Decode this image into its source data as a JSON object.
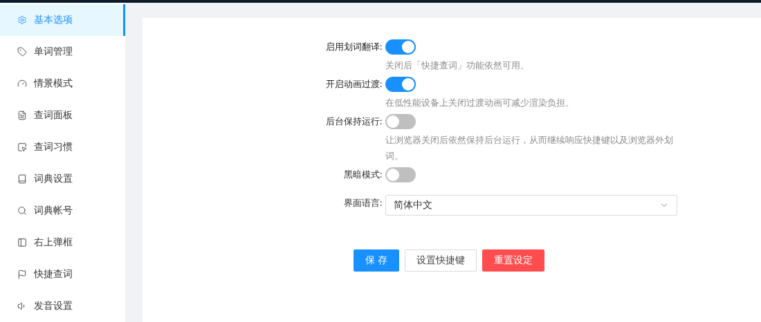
{
  "sidebar": {
    "items": [
      {
        "label": "基本选项",
        "selected": true
      },
      {
        "label": "单词管理",
        "selected": false
      },
      {
        "label": "情景模式",
        "selected": false
      },
      {
        "label": "查词面板",
        "selected": false
      },
      {
        "label": "查词习惯",
        "selected": false
      },
      {
        "label": "词典设置",
        "selected": false
      },
      {
        "label": "词典帐号",
        "selected": false
      },
      {
        "label": "右上弹框",
        "selected": false
      },
      {
        "label": "快捷查词",
        "selected": false
      },
      {
        "label": "发音设置",
        "selected": false
      }
    ]
  },
  "settings": [
    {
      "kind": "switch",
      "label": "启用划词翻译:",
      "on": true,
      "help": "关闭后「快捷查词」功能依然可用。"
    },
    {
      "kind": "switch",
      "label": "开启动画过渡:",
      "on": true,
      "help": "在低性能设备上关闭过渡动画可减少渲染负担。"
    },
    {
      "kind": "switch",
      "label": "后台保持运行:",
      "on": false,
      "help": "让浏览器关闭后依然保持后台运行，从而继续响应快捷键以及浏览器外划词。"
    },
    {
      "kind": "switch",
      "label": "黑暗模式:",
      "on": false
    },
    {
      "kind": "select",
      "label": "界面语言:",
      "value": "简体中文"
    }
  ],
  "buttons": [
    {
      "kind": "primary",
      "label": "保 存"
    },
    {
      "kind": "default",
      "label": "设置快捷键"
    },
    {
      "kind": "danger",
      "label": "重置设定"
    }
  ]
}
